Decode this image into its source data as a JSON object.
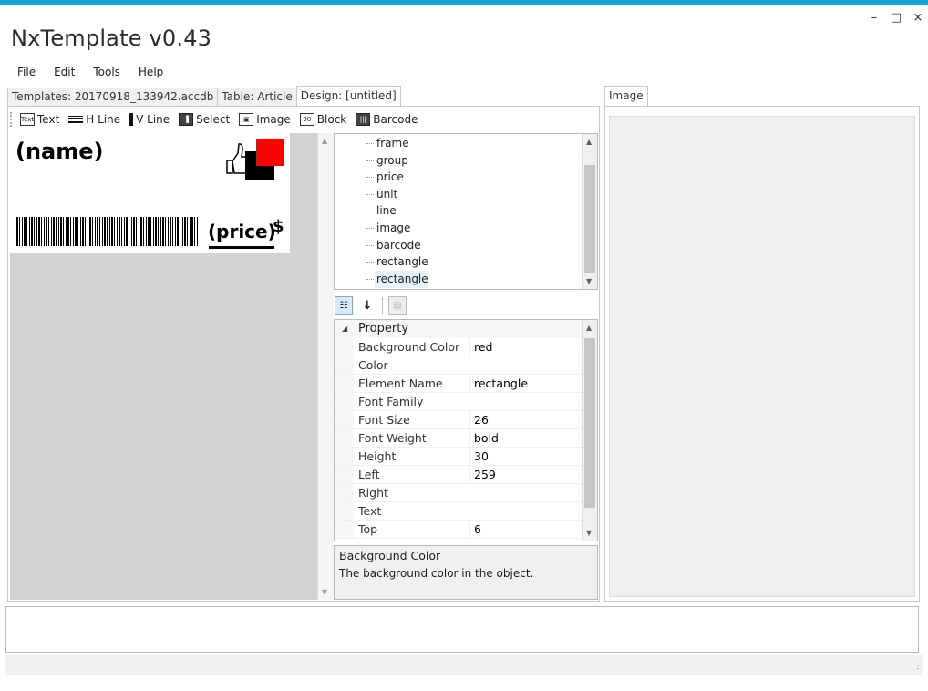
{
  "window": {
    "title": "NxTemplate v0.43",
    "controls": {
      "minimize": "–",
      "maximize": "□",
      "close": "×"
    }
  },
  "menu": [
    "File",
    "Edit",
    "Tools",
    "Help"
  ],
  "left_tabs": [
    {
      "label": "Templates: 20170918_133942.accdb"
    },
    {
      "label": "Table: Article"
    },
    {
      "label": "Design: [untitled]",
      "active": true
    }
  ],
  "right_tabs": [
    {
      "label": "Image",
      "active": true
    }
  ],
  "toolbar": {
    "tools": [
      {
        "icon": "text-tool-icon",
        "glyph": "Text",
        "label": "Text"
      },
      {
        "icon": "hline-tool-icon",
        "glyph": "",
        "label": "H Line"
      },
      {
        "icon": "vline-tool-icon",
        "glyph": "",
        "label": "V Line"
      },
      {
        "icon": "select-tool-icon",
        "glyph": "▐",
        "label": "Select"
      },
      {
        "icon": "image-tool-icon",
        "glyph": "▣",
        "label": "Image"
      },
      {
        "icon": "block-tool-icon",
        "glyph": "90",
        "label": "Block"
      },
      {
        "icon": "barcode-tool-icon",
        "glyph": "|||",
        "label": "Barcode"
      }
    ]
  },
  "design": {
    "name_field": "(name)",
    "price_field": "(price)",
    "currency": "$",
    "colors": {
      "red_rect": "#ff0000",
      "black_rect": "#000000",
      "canvas_bg": "#d2d2d2"
    }
  },
  "tree": {
    "items": [
      "frame",
      "group",
      "price",
      "unit",
      "line",
      "image",
      "barcode",
      "rectangle",
      "rectangle"
    ],
    "selected_index": 8
  },
  "property_grid": {
    "category": "Property",
    "properties": [
      {
        "name": "Background Color",
        "value": "red"
      },
      {
        "name": "Color",
        "value": ""
      },
      {
        "name": "Element Name",
        "value": "rectangle"
      },
      {
        "name": "Font Family",
        "value": ""
      },
      {
        "name": "Font Size",
        "value": "26"
      },
      {
        "name": "Font Weight",
        "value": "bold"
      },
      {
        "name": "Height",
        "value": "30"
      },
      {
        "name": "Left",
        "value": "259"
      },
      {
        "name": "Right",
        "value": ""
      },
      {
        "name": "Text",
        "value": ""
      },
      {
        "name": "Top",
        "value": "6"
      }
    ],
    "description_title": "Background Color",
    "description_text": "The background color in the object."
  }
}
